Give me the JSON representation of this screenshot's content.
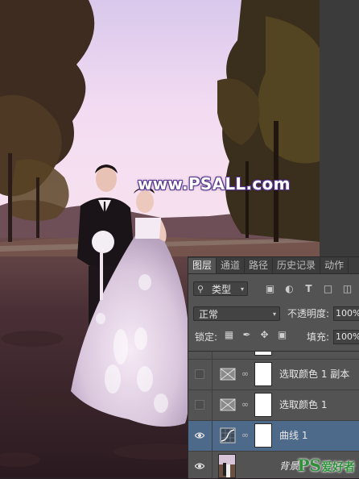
{
  "watermark": "www.PSALL.com",
  "panel": {
    "tabs": [
      {
        "label": "图层",
        "active": true
      },
      {
        "label": "通道",
        "active": false
      },
      {
        "label": "路径",
        "active": false
      },
      {
        "label": "历史记录",
        "active": false
      },
      {
        "label": "动作",
        "active": false
      }
    ],
    "filter_label": "类型",
    "filter_icons": [
      "image-filter-icon",
      "adjustment-filter-icon",
      "type-filter-icon",
      "shape-filter-icon",
      "smart-object-filter-icon"
    ],
    "blend_mode": "正常",
    "opacity_label": "不透明度:",
    "opacity_value": "100%",
    "lock_label": "锁定:",
    "fill_label": "填充:",
    "fill_value": "100%",
    "layers": [
      {
        "name": "选取颜色 1 副本",
        "visible": false,
        "selected": false,
        "type": "selective-color"
      },
      {
        "name": "选取颜色 1",
        "visible": false,
        "selected": false,
        "type": "selective-color"
      },
      {
        "name": "曲线 1",
        "visible": true,
        "selected": true,
        "type": "curves"
      },
      {
        "name": "背景",
        "visible": true,
        "selected": false,
        "type": "background"
      }
    ]
  },
  "badge": {
    "ps": "PS",
    "cn": "爱好者"
  },
  "colors": {
    "sky": "#f2dcf0",
    "panel_bg": "#535353",
    "selected_layer": "#4e6a8a",
    "watermark_outline": "#5a3aa0"
  }
}
